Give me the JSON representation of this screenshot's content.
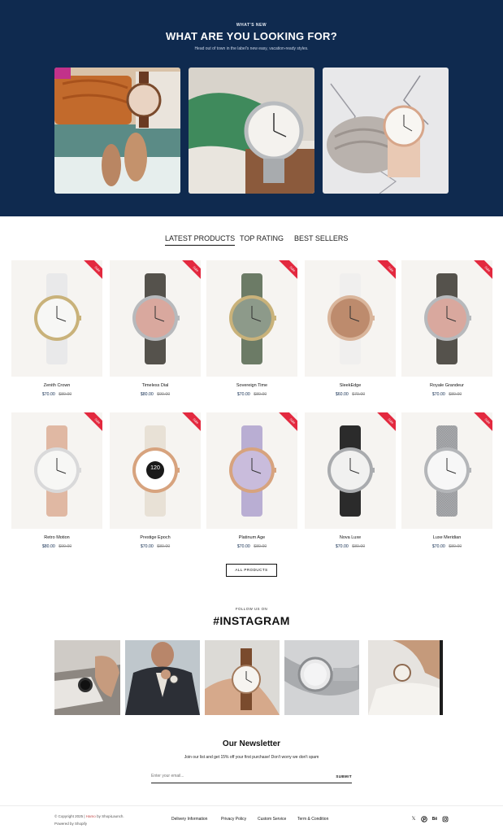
{
  "hero": {
    "eyebrow": "WHAT'S NEW",
    "title": "WHAT ARE YOU LOOKING FOR?",
    "subtitle": "Head out of town in the label's new easy, vacation-ready styles."
  },
  "tabs": [
    "LATEST PRODUCTS",
    "TOP RATING",
    "BEST SELLERS"
  ],
  "sale_label": "Sale",
  "products": [
    {
      "name": "Zenith Crown",
      "price": "$70.00",
      "old_price": "$80.00"
    },
    {
      "name": "Timeless Dial",
      "price": "$80.00",
      "old_price": "$90.00"
    },
    {
      "name": "Sovereign Time",
      "price": "$70.00",
      "old_price": "$80.00"
    },
    {
      "name": "SleekEdge",
      "price": "$60.00",
      "old_price": "$70.00"
    },
    {
      "name": "Royale Grandeur",
      "price": "$70.00",
      "old_price": "$80.00"
    },
    {
      "name": "Retro Motion",
      "price": "$80.00",
      "old_price": "$90.00"
    },
    {
      "name": "Prestige Epoch",
      "price": "$70.00",
      "old_price": "$80.00"
    },
    {
      "name": "Platinum Age",
      "price": "$70.00",
      "old_price": "$80.00"
    },
    {
      "name": "Nova Luxe",
      "price": "$70.00",
      "old_price": "$80.00"
    },
    {
      "name": "Luxe Meridian",
      "price": "$70.00",
      "old_price": "$80.00"
    }
  ],
  "all_products_label": "ALL PRODUCTS",
  "instagram": {
    "eyebrow": "FOLLOW US ON",
    "title": "#INSTAGRAM"
  },
  "newsletter": {
    "title": "Our Newsletter",
    "text": "Join our list and get 15% off your first purchase! Don't worry we don't spam",
    "placeholder": "Enter your email...",
    "button": "SUBMIT"
  },
  "footer": {
    "copyright_prefix": "© Copyright 2025 |",
    "copyright_brand": "Hamo",
    "copyright_suffix": "by ShopiLaunch.",
    "powered": "Powered by Shopify",
    "links": [
      "Delivery Information",
      "Privacy Policy",
      "Custom Service",
      "Term & Condition"
    ],
    "social_icons": [
      "x-icon",
      "pinterest-icon",
      "behance-icon",
      "instagram-icon"
    ]
  },
  "colors": {
    "hero_bg": "#0f2a4f",
    "sale": "#e3293f",
    "price": "#0f2a4f"
  }
}
